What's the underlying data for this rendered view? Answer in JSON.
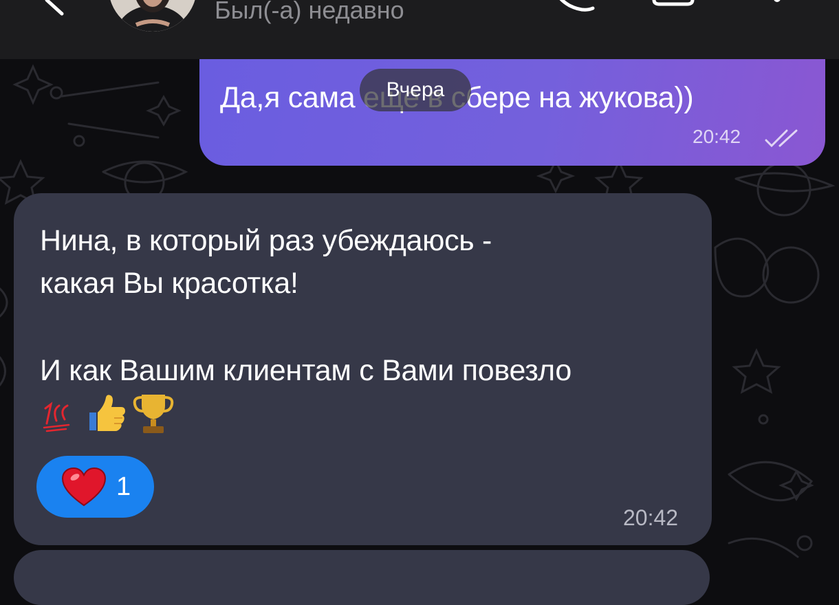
{
  "header": {
    "status": "Был(-а) недавно"
  },
  "outgoing": {
    "text": "Да,я сама еще в сбере на жукова))",
    "time": "20:42"
  },
  "date_divider": "Вчера",
  "incoming": {
    "lines": [
      "Нина, в который раз убеждаюсь -",
      "какая Вы красотка!",
      "",
      "И как Вашим клиентам с Вами повезло"
    ],
    "emoji_100": "💯",
    "reaction_count": "1",
    "time": "20:42"
  },
  "colors": {
    "background": "#0d0d10",
    "header": "#1c1c1e",
    "outgoing_gradient_start": "#6a5de0",
    "outgoing_gradient_end": "#8a57d2",
    "incoming_bubble": "#363848",
    "reaction": "#1a82f0"
  },
  "icons": [
    "back-icon",
    "call-icon",
    "video-icon",
    "more-icon",
    "double-check-icon",
    "heart-icon",
    "thumbs-up-icon",
    "trophy-icon"
  ]
}
